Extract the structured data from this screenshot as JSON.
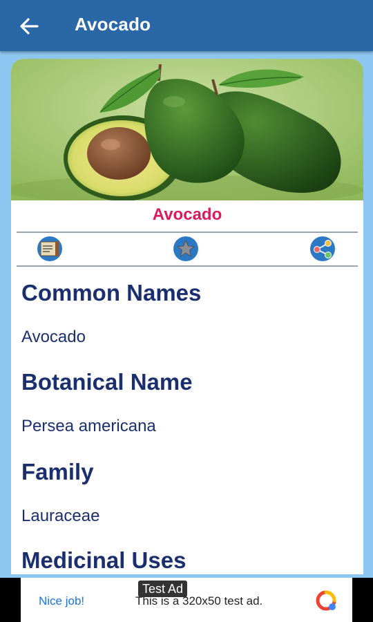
{
  "appbar": {
    "title": "Avocado"
  },
  "plant": {
    "name": "Avocado"
  },
  "actions": [
    "notes-icon",
    "star-icon",
    "share-icon"
  ],
  "sections": [
    {
      "heading": "Common Names",
      "value": "Avocado"
    },
    {
      "heading": "Botanical Name",
      "value": "Persea americana"
    },
    {
      "heading": "Family",
      "value": "Lauraceae"
    },
    {
      "heading": "Medicinal Uses",
      "value": ""
    }
  ],
  "ad": {
    "label": "Test Ad",
    "nice": "Nice job!",
    "text": "This is a 320x50 test ad."
  },
  "colors": {
    "appbar": "#2a67a6",
    "background": "#8ec6f2",
    "title_accent": "#d81b60",
    "heading": "#1b2f6e"
  }
}
